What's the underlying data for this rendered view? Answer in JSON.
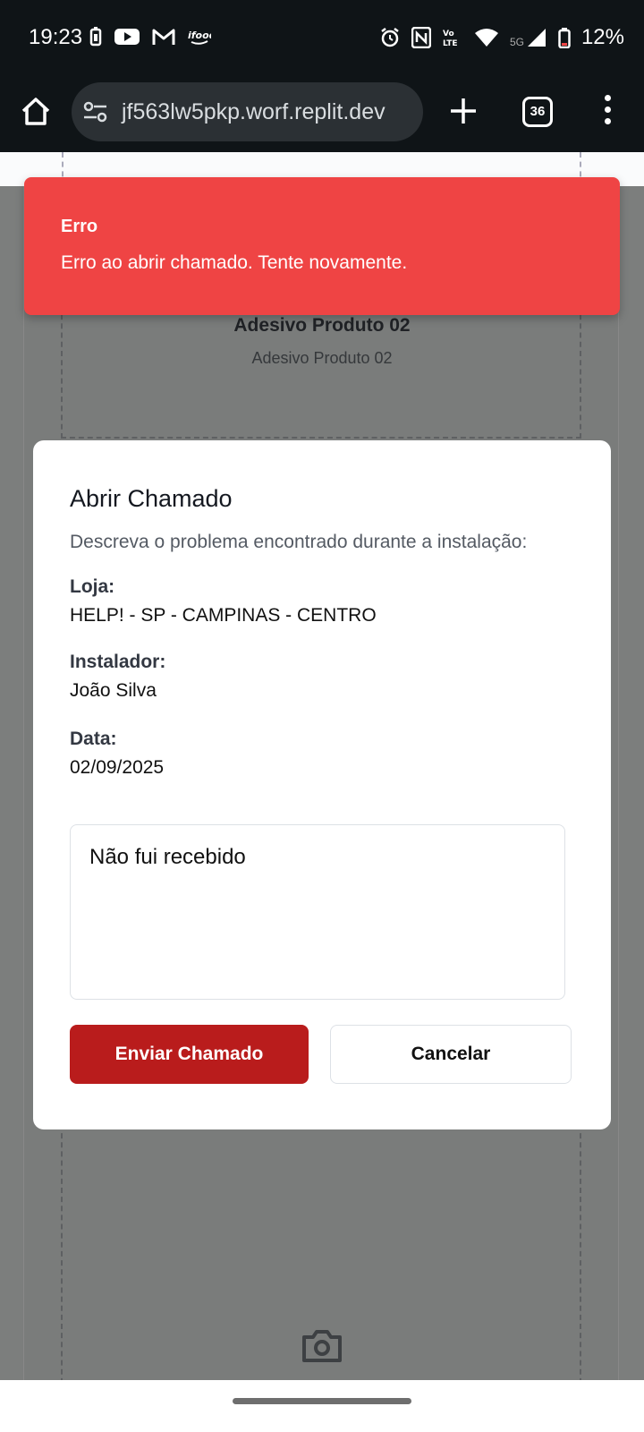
{
  "status_bar": {
    "time": "19:23",
    "network": "5G",
    "battery": "12%",
    "icons": [
      "battery-saver-icon",
      "youtube-icon",
      "gmail-icon",
      "ifood-icon",
      "alarm-icon",
      "nfc-icon",
      "volte-icon",
      "wifi-icon",
      "signal-icon",
      "battery-icon"
    ]
  },
  "browser": {
    "url": "jf563lw5pkp.worf.replit.dev",
    "tab_count": "36",
    "icons": [
      "home-icon",
      "site-settings-icon",
      "new-tab-icon",
      "tabs-icon",
      "more-menu-icon"
    ]
  },
  "page": {
    "product_title": "Adesivo Produto 02",
    "product_subtitle": "Adesivo Produto 02"
  },
  "toast": {
    "title": "Erro",
    "message": "Erro ao abrir chamado. Tente novamente.",
    "color": "#ef4444"
  },
  "modal": {
    "title": "Abrir Chamado",
    "description": "Descreva o problema encontrado durante a instalação:",
    "fields": [
      {
        "label": "Loja:",
        "value": "HELP! - SP - CAMPINAS - CENTRO"
      },
      {
        "label": "Instalador:",
        "value": "João Silva"
      },
      {
        "label": "Data:",
        "value": "02/09/2025"
      }
    ],
    "textarea_value": "Não fui recebido",
    "submit_label": "Enviar Chamado",
    "cancel_label": "Cancelar",
    "submit_color": "#b91c1c"
  }
}
